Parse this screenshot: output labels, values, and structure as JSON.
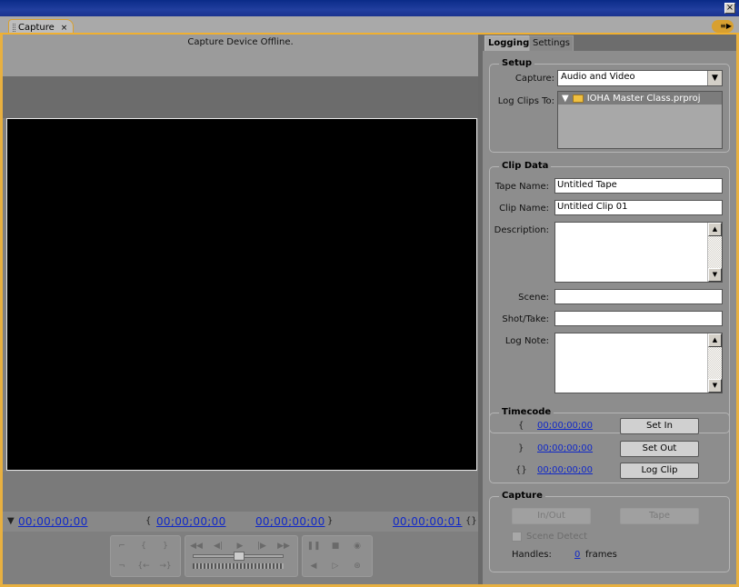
{
  "window": {
    "close_glyph": "×"
  },
  "panel_tab": {
    "label": "Capture",
    "close_glyph": "×",
    "menu_glyph": "≡▶"
  },
  "monitor": {
    "status": "Capture Device Offline.",
    "timecodes": {
      "current": "00;00;00;00",
      "in": "00;00;00;00",
      "out": "00;00;00;00",
      "duration": "00;00;00;01"
    }
  },
  "transport": {
    "icons": [
      "set-in-icon",
      "go-to-in-icon",
      "go-to-out-icon",
      "set-out-icon",
      "rewind-icon",
      "step-back-icon",
      "play-icon",
      "step-forward-icon",
      "fast-forward-icon",
      "pause-icon",
      "stop-icon",
      "record-icon",
      "shuttle-icon",
      "jog-icon",
      "slow-reverse-icon",
      "slow-play-icon",
      "scene-search-icon"
    ]
  },
  "right_tabs": {
    "logging": "Logging",
    "settings": "Settings"
  },
  "setup": {
    "title": "Setup",
    "capture_label": "Capture:",
    "capture_value": "Audio and Video",
    "log_clips_label": "Log Clips To:",
    "project": "IOHA Master Class.prproj"
  },
  "clip_data": {
    "title": "Clip Data",
    "tape_name_label": "Tape Name:",
    "tape_name_value": "Untitled Tape",
    "clip_name_label": "Clip Name:",
    "clip_name_value": "Untitled Clip 01",
    "description_label": "Description:",
    "scene_label": "Scene:",
    "shot_take_label": "Shot/Take:",
    "log_note_label": "Log Note:"
  },
  "timecode": {
    "title": "Timecode",
    "in_value": "00;00;00;00",
    "out_value": "00;00;00;00",
    "duration_value": "00;00;00;00",
    "set_in": "Set In",
    "set_out": "Set Out",
    "log_clip": "Log Clip"
  },
  "capture": {
    "title": "Capture",
    "in_out": "In/Out",
    "tape": "Tape",
    "scene_detect": "Scene Detect",
    "handles_label": "Handles:",
    "handles_value": "0",
    "handles_unit": "frames"
  }
}
